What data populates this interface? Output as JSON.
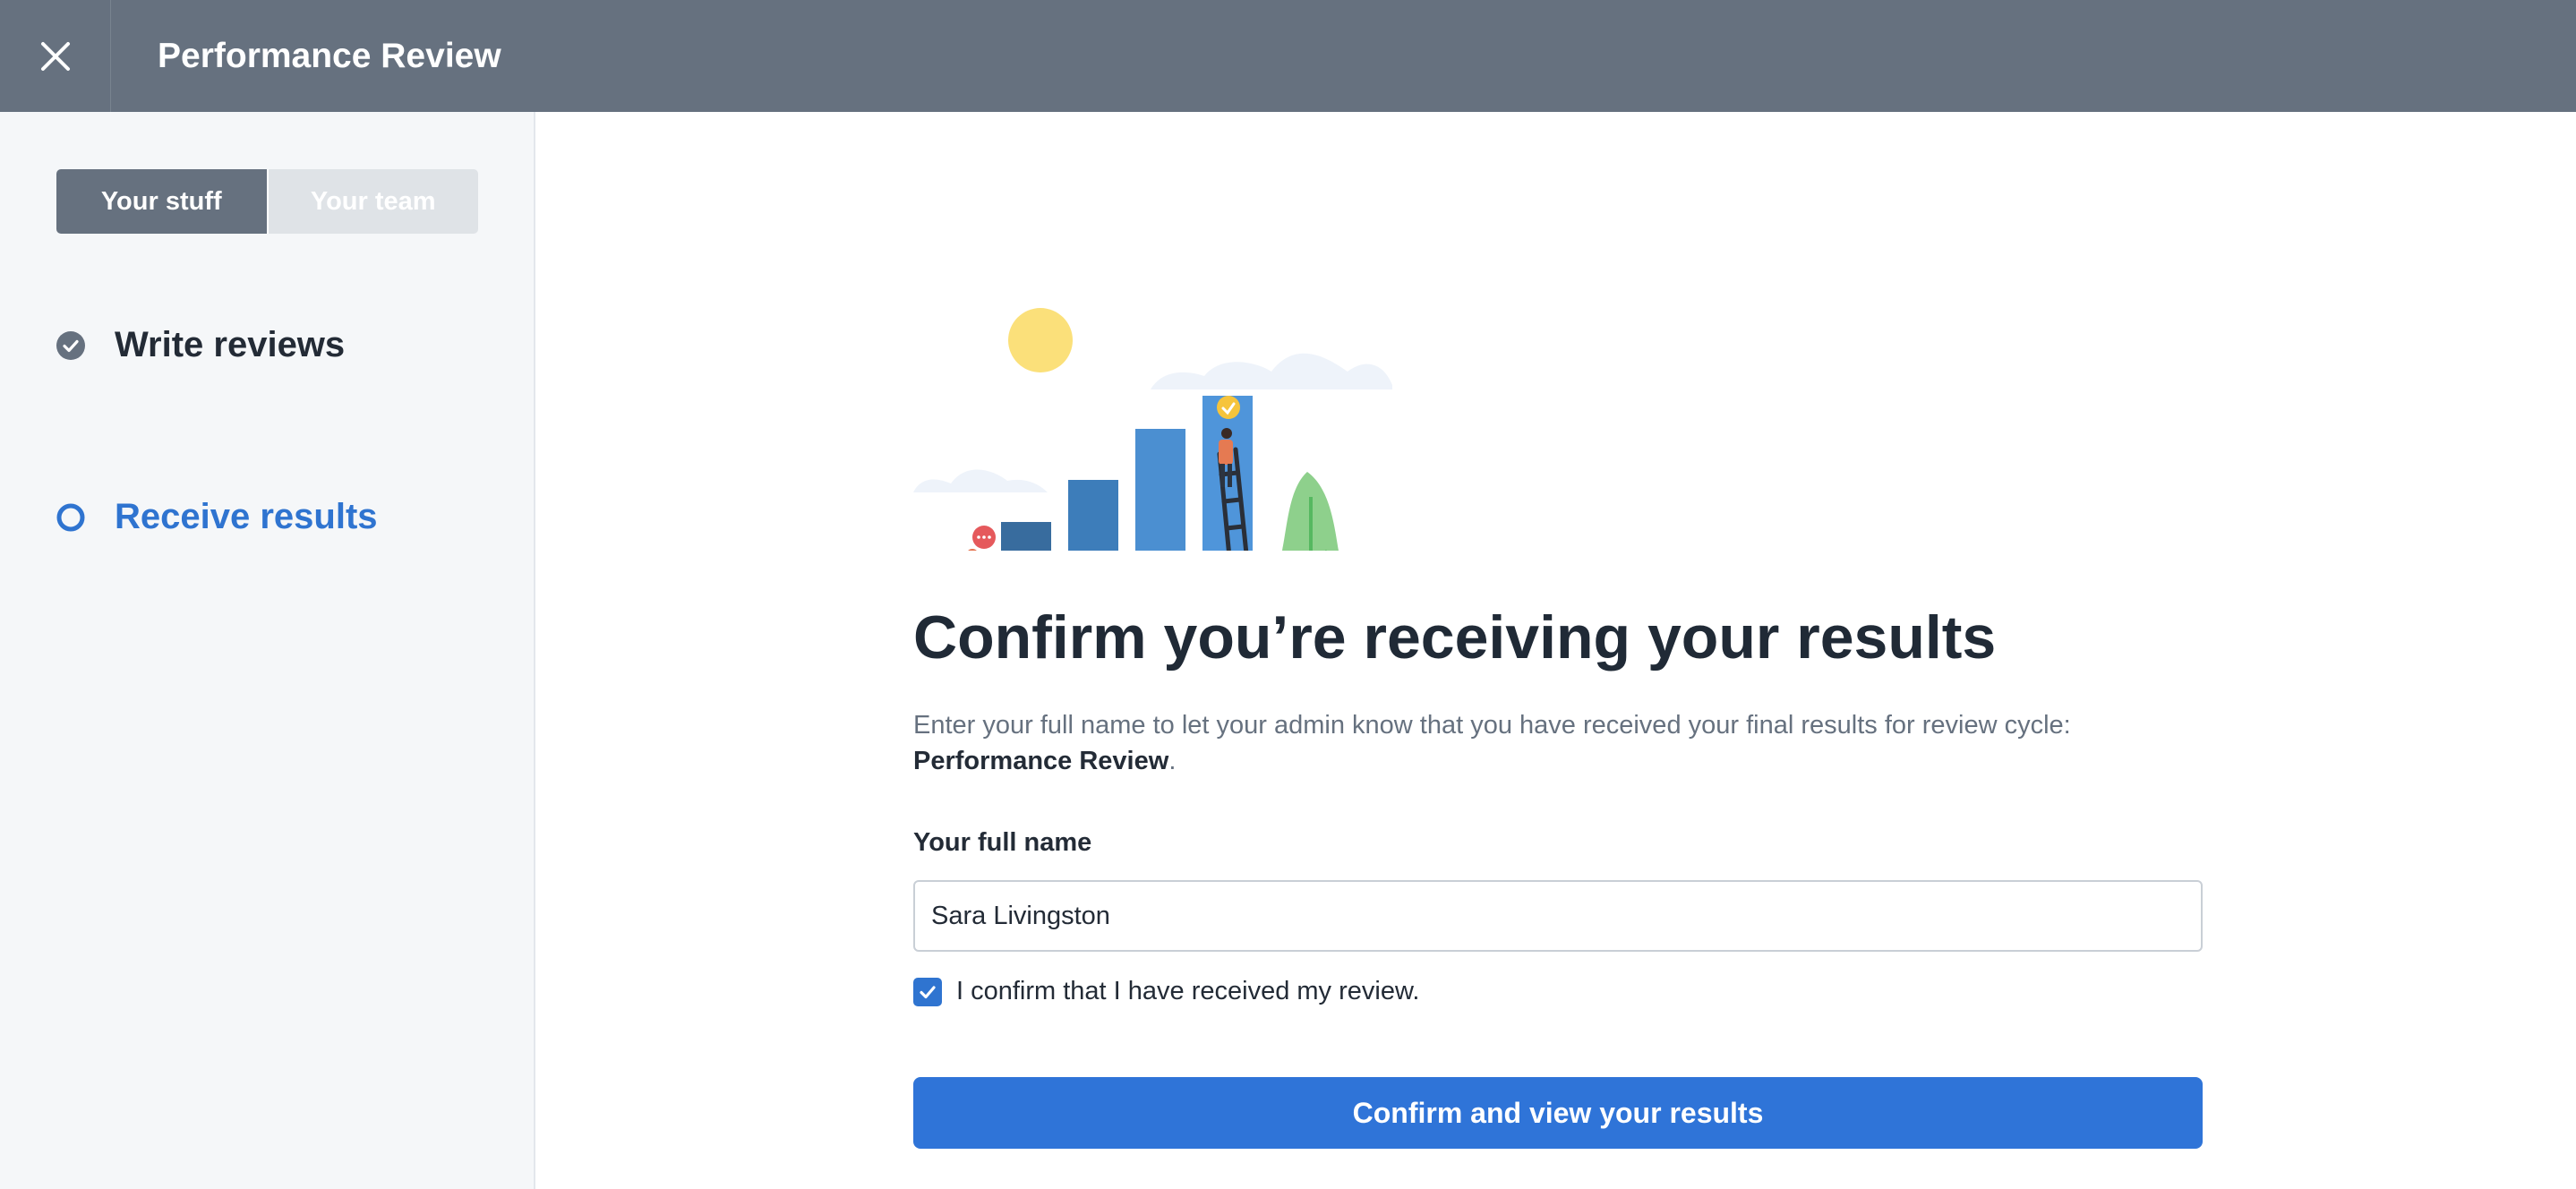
{
  "header": {
    "title": "Performance Review",
    "close_icon": "close-icon"
  },
  "sidebar": {
    "tabs": [
      {
        "label": "Your stuff",
        "active": true
      },
      {
        "label": "Your team",
        "active": false
      }
    ],
    "steps": [
      {
        "label": "Write reviews",
        "status": "complete",
        "icon": "check-circle-icon"
      },
      {
        "label": "Receive results",
        "status": "current",
        "icon": "ring-icon"
      }
    ]
  },
  "main": {
    "heading": "Confirm you’re receiving your results",
    "description": "Enter your full name to let your admin know that you have received your final results for review cycle:",
    "description_bold": "Performance Review",
    "description_end": ".",
    "name_label": "Your full name",
    "name_value": "Sara Livingston",
    "confirm_checked": true,
    "confirm_text": "I confirm that I have received my review.",
    "submit_label": "Confirm and view your results"
  },
  "colors": {
    "topbar": "#66717f",
    "accent": "#2f74d0",
    "sidebar_bg": "#f5f7f9"
  }
}
